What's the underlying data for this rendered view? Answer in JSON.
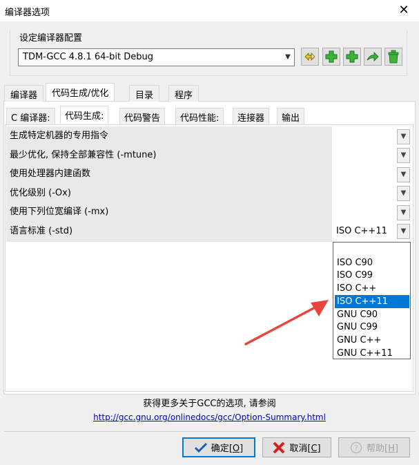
{
  "window": {
    "title": "编译器选项",
    "close_glyph": "✕"
  },
  "config_group": {
    "label": "设定编译器配置",
    "selected": "TDM-GCC 4.8.1 64-bit Debug",
    "toolbar_icons": [
      "rename-config-icon",
      "add-config-icon",
      "add-config-icon-2",
      "copy-config-icon",
      "delete-config-icon"
    ]
  },
  "tabs": [
    "编译器",
    "代码生成/优化",
    "目录",
    "程序"
  ],
  "subtabs": [
    "C 编译器:",
    "代码生成:",
    "代码警告",
    "代码性能:",
    "连接器",
    "输出"
  ],
  "options": [
    {
      "label": "生成特定机器的专用指令",
      "value": ""
    },
    {
      "label": "最少优化, 保持全部兼容性 (-mtune)",
      "value": ""
    },
    {
      "label": "使用处理器内建函数",
      "value": ""
    },
    {
      "label": "优化级别 (-Ox)",
      "value": ""
    },
    {
      "label": "使用下列位宽编译 (-mx)",
      "value": ""
    },
    {
      "label": "语言标准 (-std)",
      "value": "ISO C++11"
    }
  ],
  "std_dropdown": {
    "options": [
      "",
      "ISO C90",
      "ISO C99",
      "ISO C++",
      "ISO C++11",
      "GNU C90",
      "GNU C99",
      "GNU C++",
      "GNU C++11"
    ],
    "selected": "ISO C++11"
  },
  "info": {
    "text": "获得更多关于GCC的选项, 请参阅",
    "link": "http://gcc.gnu.org/onlinedocs/gcc/Option-Summary.html"
  },
  "buttons": {
    "ok": {
      "label": "确定",
      "accel": "O"
    },
    "cancel": {
      "label": "取消",
      "accel": "C"
    },
    "help": {
      "label": "帮助",
      "accel": "H"
    }
  },
  "colors": {
    "selection": "#0078d7",
    "arrow": "#e8463c",
    "link": "#0000cc"
  }
}
